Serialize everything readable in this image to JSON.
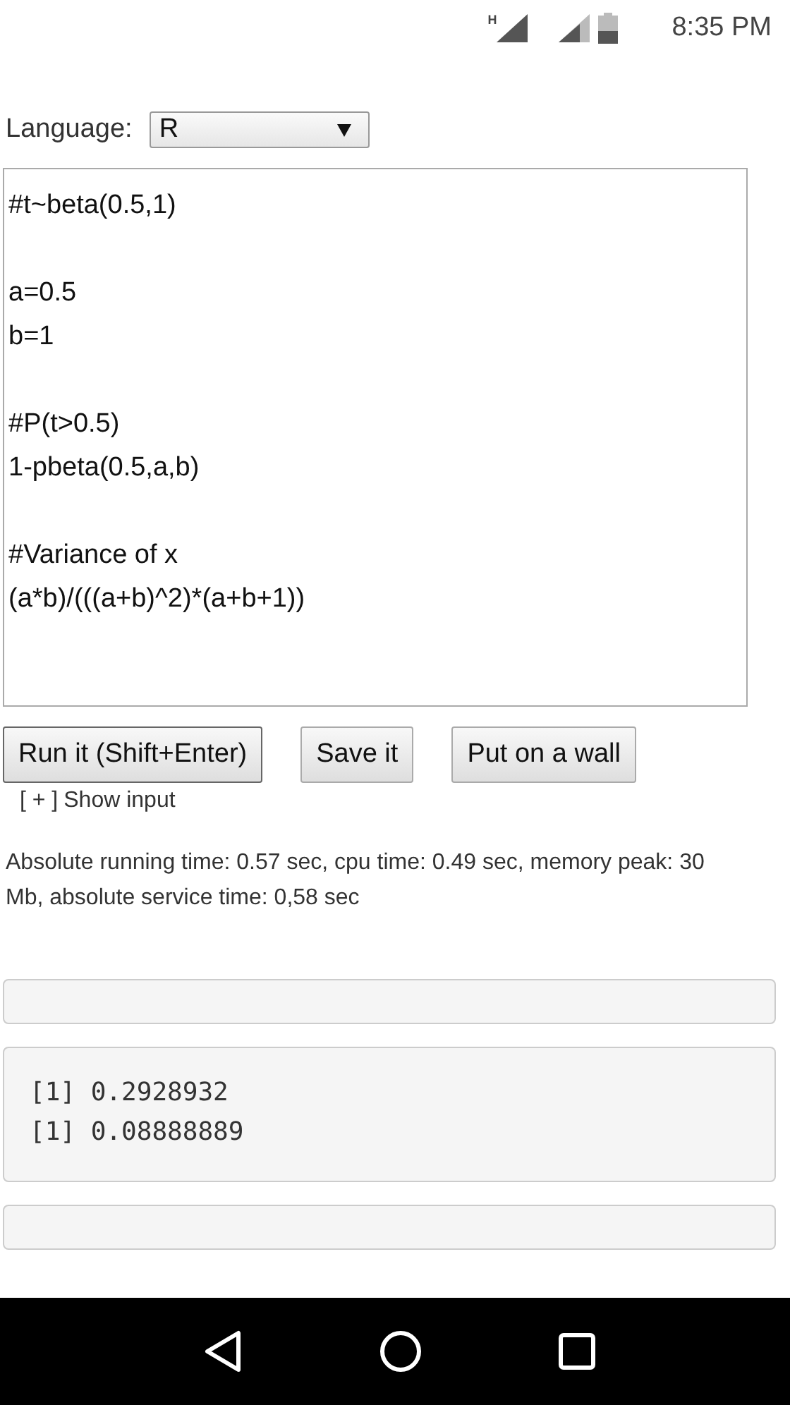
{
  "status_bar": {
    "network_label": "H",
    "time": "8:35 PM"
  },
  "language": {
    "label": "Language:",
    "value": "R"
  },
  "code": "#t~beta(0.5,1)\n\na=0.5\nb=1\n\n#P(t>0.5)\n1-pbeta(0.5,a,b)\n\n#Variance of x\n(a*b)/(((a+b)^2)*(a+b+1))",
  "buttons": [
    "Run it (Shift+Enter)",
    "Save it",
    "Put on a wall"
  ],
  "show_input": {
    "toggle": "[ + ]",
    "label": "Show input"
  },
  "stats": "Absolute running time: 0.57 sec, cpu time: 0.49 sec, memory peak: 30 Mb, absolute service time: 0,58 sec",
  "outputs": [
    {
      "kind": "empty"
    },
    {
      "kind": "text",
      "lines": [
        "[1] 0.2928932",
        "[1] 0.08888889"
      ]
    },
    {
      "kind": "empty"
    }
  ]
}
